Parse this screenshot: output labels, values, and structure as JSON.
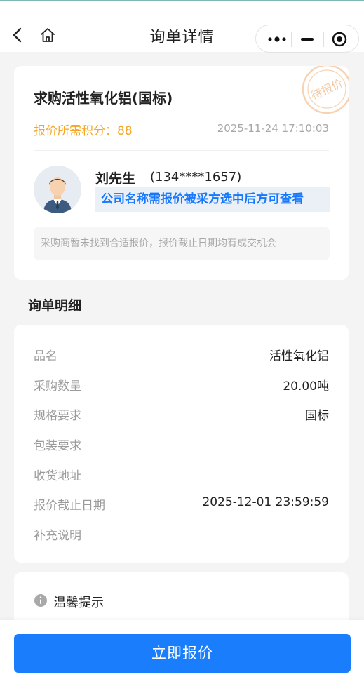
{
  "nav": {
    "title": "询单详情"
  },
  "inquiry": {
    "title": "求购活性氧化铝(国标)",
    "points_label": "报价所需积分：",
    "points_value": "88",
    "datetime": "2025-11-24 17:10:03",
    "stamp_text": "待报价",
    "contact_name": "刘先生",
    "contact_phone": "(134****1657)",
    "company_notice": "公司名称需报价被采方选中后方可查看",
    "tip": "采购商暂未找到合适报价，报价截止日期均有成交机会"
  },
  "details": {
    "section_title": "询单明细",
    "rows": [
      {
        "label": "品名",
        "value": "活性氧化铝"
      },
      {
        "label": "采购数量",
        "value": "20.00吨"
      },
      {
        "label": "规格要求",
        "value": "国标"
      },
      {
        "label": "包装要求",
        "value": ""
      },
      {
        "label": "收货地址",
        "value": ""
      },
      {
        "label": "报价截止日期",
        "value": "2025-12-01 23:59:59"
      },
      {
        "label": "补充说明",
        "value": ""
      }
    ]
  },
  "notice": {
    "title": "温馨提示"
  },
  "actions": {
    "quote_label": "立即报价"
  },
  "colors": {
    "accent": "#1a7dfc",
    "points": "#f5a623",
    "stamp": "#f4c49a"
  }
}
